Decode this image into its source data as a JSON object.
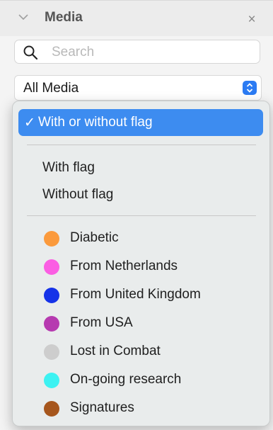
{
  "panel": {
    "title": "Media",
    "close_label": "×",
    "icons": {
      "collapse": "chevron-down-icon",
      "close": "close-icon",
      "search": "search-icon",
      "select_arrow": "select-arrow-icon"
    }
  },
  "search": {
    "placeholder": "Search",
    "value": ""
  },
  "filter_select": {
    "selected_label": "All Media",
    "accent_color": "#2b7bf3"
  },
  "dropdown": {
    "check_mark": "✓",
    "flag_options": [
      {
        "label": "With or without flag",
        "selected": true
      },
      {
        "label": "With flag",
        "selected": false
      },
      {
        "label": "Without flag",
        "selected": false
      }
    ],
    "tags": [
      {
        "label": "Diabetic",
        "color": "#fb9a3c"
      },
      {
        "label": "From Netherlands",
        "color": "#fb5ee3"
      },
      {
        "label": "From United Kingdom",
        "color": "#1532e8"
      },
      {
        "label": "From USA",
        "color": "#b63ab0"
      },
      {
        "label": "Lost in Combat",
        "color": "#cdcdcd"
      },
      {
        "label": "On-going research",
        "color": "#3df2f2"
      },
      {
        "label": "Signatures",
        "color": "#a6561d"
      }
    ],
    "selected_color": "#3d8cf0"
  }
}
